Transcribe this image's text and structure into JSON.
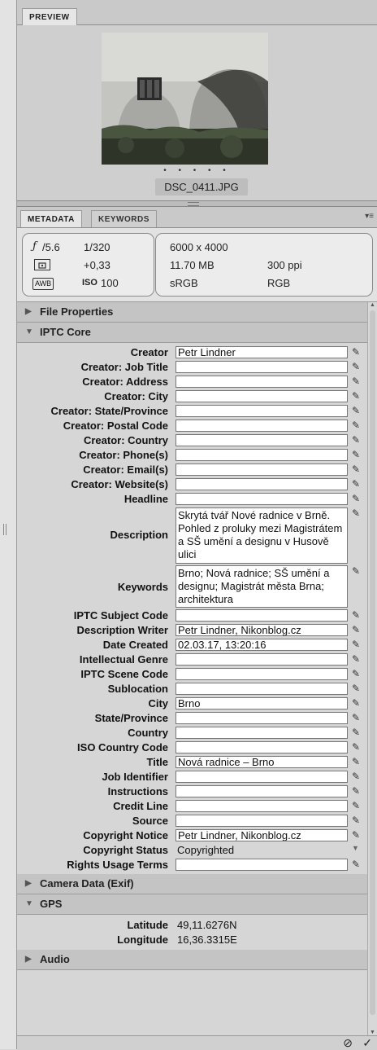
{
  "preview": {
    "tab": "PREVIEW",
    "dots": "• • • • •",
    "filename": "DSC_0411.JPG"
  },
  "tabs": {
    "metadata": "METADATA",
    "keywords": "KEYWORDS",
    "menu_icon": "panel-menu-icon"
  },
  "camera": {
    "aperture_f": "ƒ",
    "aperture_value": "/5.6",
    "shutter": "1/320",
    "exposure_comp": "+0,33",
    "iso_label": "ISO",
    "iso_value": "100",
    "wb": "AWB"
  },
  "file_info": {
    "dimensions": "6000 x 4000",
    "size": "11.70 MB",
    "resolution": "300 ppi",
    "profile": "sRGB",
    "mode": "RGB"
  },
  "sections": {
    "file_properties": "File Properties",
    "iptc_core": "IPTC Core",
    "camera_data": "Camera Data (Exif)",
    "gps": "GPS",
    "audio": "Audio"
  },
  "iptc": {
    "creator": {
      "label": "Creator",
      "value": "Petr Lindner"
    },
    "creator_job_title": {
      "label": "Creator: Job Title",
      "value": ""
    },
    "creator_address": {
      "label": "Creator: Address",
      "value": ""
    },
    "creator_city": {
      "label": "Creator: City",
      "value": ""
    },
    "creator_state": {
      "label": "Creator: State/Province",
      "value": ""
    },
    "creator_postal": {
      "label": "Creator: Postal Code",
      "value": ""
    },
    "creator_country": {
      "label": "Creator: Country",
      "value": ""
    },
    "creator_phone": {
      "label": "Creator: Phone(s)",
      "value": ""
    },
    "creator_email": {
      "label": "Creator: Email(s)",
      "value": ""
    },
    "creator_website": {
      "label": "Creator: Website(s)",
      "value": ""
    },
    "headline": {
      "label": "Headline",
      "value": ""
    },
    "description": {
      "label": "Description",
      "value": "Skrytá tvář Nové radnice v Brně. Pohled z proluky mezi Magistrátem a SŠ umění a designu v Husově ulici"
    },
    "keywords": {
      "label": "Keywords",
      "value": "Brno; Nová radnice; SŠ umění a designu; Magistrát města Brna; architektura"
    },
    "subject_code": {
      "label": "IPTC Subject Code",
      "value": ""
    },
    "description_writer": {
      "label": "Description Writer",
      "value": "Petr Lindner, Nikonblog.cz"
    },
    "date_created": {
      "label": "Date Created",
      "value": "02.03.17, 13:20:16"
    },
    "intellectual_genre": {
      "label": "Intellectual Genre",
      "value": ""
    },
    "scene_code": {
      "label": "IPTC Scene Code",
      "value": ""
    },
    "sublocation": {
      "label": "Sublocation",
      "value": ""
    },
    "city": {
      "label": "City",
      "value": "Brno"
    },
    "state": {
      "label": "State/Province",
      "value": ""
    },
    "country": {
      "label": "Country",
      "value": ""
    },
    "iso_country_code": {
      "label": "ISO Country Code",
      "value": ""
    },
    "title": {
      "label": "Title",
      "value": "Nová radnice – Brno"
    },
    "job_identifier": {
      "label": "Job Identifier",
      "value": ""
    },
    "instructions": {
      "label": "Instructions",
      "value": ""
    },
    "credit_line": {
      "label": "Credit Line",
      "value": ""
    },
    "source": {
      "label": "Source",
      "value": ""
    },
    "copyright_notice": {
      "label": "Copyright Notice",
      "value": "Petr Lindner, Nikonblog.cz"
    },
    "copyright_status": {
      "label": "Copyright Status",
      "value": "Copyrighted"
    },
    "rights_usage": {
      "label": "Rights Usage Terms",
      "value": ""
    }
  },
  "gps": {
    "latitude": {
      "label": "Latitude",
      "value": "49,11.6276N"
    },
    "longitude": {
      "label": "Longitude",
      "value": "16,36.3315E"
    }
  },
  "bottom": {
    "cancel": "⊘",
    "apply": "✓"
  }
}
